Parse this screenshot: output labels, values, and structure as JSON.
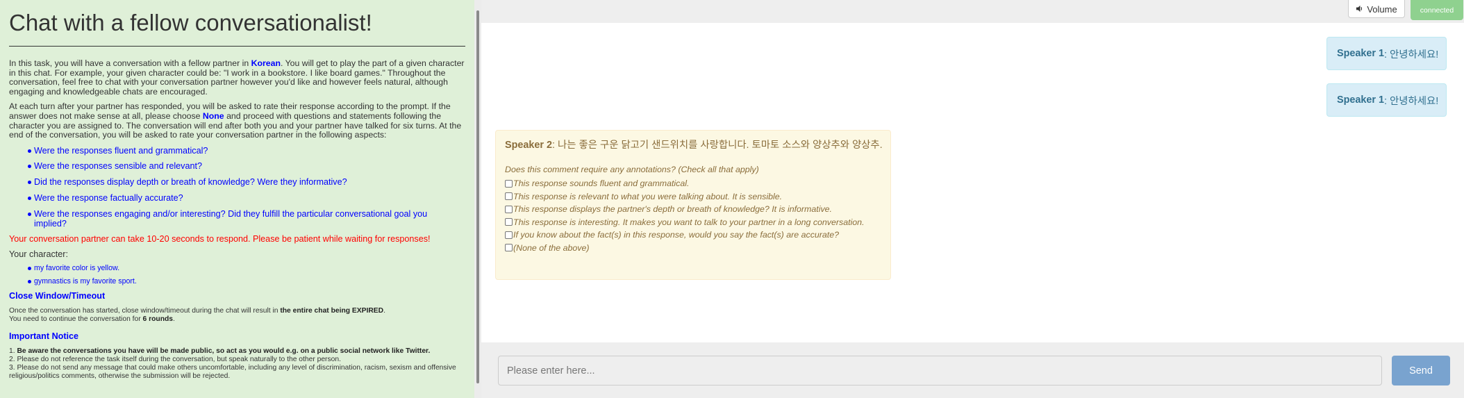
{
  "instructions": {
    "title": "Chat with a fellow conversationalist!",
    "intro_before": "In this task, you will have a conversation with a fellow partner in ",
    "language": "Korean",
    "intro_after": ". You will get to play the part of a given character in this chat. For example, your given character could be: \"I work in a bookstore. I like board games.\" Throughout the conversation, feel free to chat with your conversation partner however you'd like and however feels natural, although engaging and knowledgeable chats are encouraged.",
    "rate_before": "At each turn after your partner has responded, you will be asked to rate their response according to the prompt. If the answer does not make sense at all, please choose ",
    "none_word": "None",
    "rate_after": " and proceed with questions and statements following the character you are assigned to. The conversation will end after both you and your partner have talked for six turns. At the end of the conversation, you will be asked to rate your conversation partner in the following aspects:",
    "aspects": [
      "Were the responses fluent and grammatical?",
      "Were the responses sensible and relevant?",
      "Did the responses display depth or breath of knowledge? Were they informative?",
      "Were the response factually accurate?",
      "Were the responses engaging and/or interesting? Did they fulfill the particular conversational goal you implied?"
    ],
    "patience_warning": "Your conversation partner can take 10-20 seconds to respond. Please be patient while waiting for responses!",
    "character_label": "Your character:",
    "character_traits": [
      "my favorite color is yellow.",
      "gymnastics is my favorite sport."
    ],
    "timeout_title": "Close Window/Timeout",
    "timeout_text_1": "Once the conversation has started, close window/timeout during the chat will result in ",
    "timeout_text_bold": "the entire chat being EXPIRED",
    "timeout_text_2": ".",
    "rounds_text_1": "You need to continue the conversation for ",
    "rounds_text_bold": "6 rounds",
    "rounds_text_2": ".",
    "notice_title": "Important Notice",
    "notice_1_num": "1. ",
    "notice_1_bold": "Be aware the conversations you have will be made public, so act as you would e.g. on a public social network like Twitter.",
    "notice_2": "2. Please do not reference the task itself during the conversation, but speak naturally to the other person.",
    "notice_3": "3. Please do not send any message that could make others uncomfortable, including any level of discrimination, racism, sexism and offensive religious/politics comments, otherwise the submission will be rejected."
  },
  "topbar": {
    "volume_icon": "speaker-icon",
    "volume_label": "Volume",
    "status_label": "connected",
    "status_color": "#8fd18f"
  },
  "messages": [
    {
      "speaker": "Speaker 1",
      "text": ": 안녕하세요!"
    },
    {
      "speaker": "Speaker 1",
      "text": ": 안녕하세요!"
    },
    {
      "speaker": "Speaker 2",
      "text": ": 나는 좋은 구운 닭고기 샌드위치를 사랑합니다. 토마토 소스와 양상추와 양상추."
    }
  ],
  "annotation": {
    "question": "Does this comment require any annotations? (Check all that apply)",
    "options": [
      "This response sounds fluent and grammatical.",
      "This response is relevant to what you were talking about. It is sensible.",
      "This response displays the partner's depth or breath of knowledge? It is informative.",
      "This response is interesting. It makes you want to talk to your partner in a long conversation.",
      "If you know about the fact(s) in this response, would you say the fact(s) are accurate?",
      "(None of the above)"
    ]
  },
  "input": {
    "placeholder": "Please enter here...",
    "send_label": "Send",
    "send_color": "#79a3cf"
  }
}
